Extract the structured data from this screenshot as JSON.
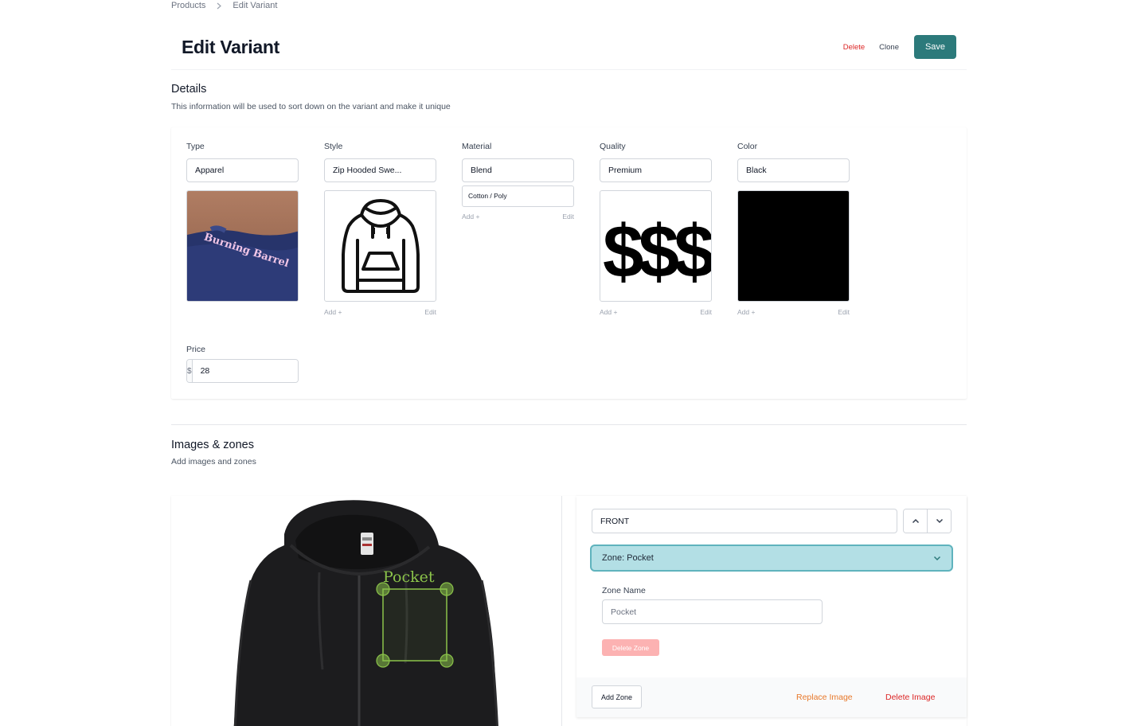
{
  "breadcrumb": {
    "products": "Products",
    "current": "Edit Variant"
  },
  "header": {
    "title": "Edit Variant",
    "delete_label": "Delete",
    "clone_label": "Clone",
    "save_label": "Save"
  },
  "details": {
    "title": "Details",
    "subtitle": "This information will be used to sort down on the variant and make it unique",
    "fields": [
      {
        "label": "Type",
        "value": "Apparel",
        "image": "tshirt-photo"
      },
      {
        "label": "Style",
        "value": "Zip Hooded Swe...",
        "image": "hoodie-outline-icon",
        "add": "Add +",
        "edit": "Edit"
      },
      {
        "label": "Material",
        "value": "Blend",
        "option": "Cotton / Poly",
        "add": "Add +",
        "edit": "Edit"
      },
      {
        "label": "Quality",
        "value": "Premium",
        "image": "dollar-signs",
        "image_text": "$$$",
        "add": "Add +",
        "edit": "Edit"
      },
      {
        "label": "Color",
        "value": "Black",
        "swatch": "#000000",
        "add": "Add +",
        "edit": "Edit"
      }
    ],
    "shirt_text": "Burning Barrel",
    "price": {
      "label": "Price",
      "prefix": "$",
      "value": "28"
    }
  },
  "images": {
    "title": "Images & zones",
    "subtitle": "Add images and zones",
    "zone_overlay_label": "Pocket",
    "view": "FRONT",
    "zone_header": "Zone: Pocket",
    "zone_name_label": "Zone Name",
    "zone_name_placeholder": "Pocket",
    "delete_zone_label": "Delete Zone",
    "add_zone_label": "Add Zone",
    "replace_image_label": "Replace Image",
    "delete_image_label": "Delete Image"
  },
  "colors": {
    "primary": "#2c7a7b",
    "danger": "#dc2626",
    "warning": "#e8782a",
    "zone_highlight": "#b3dfe5",
    "zone_overlay": "#8bc34a"
  }
}
